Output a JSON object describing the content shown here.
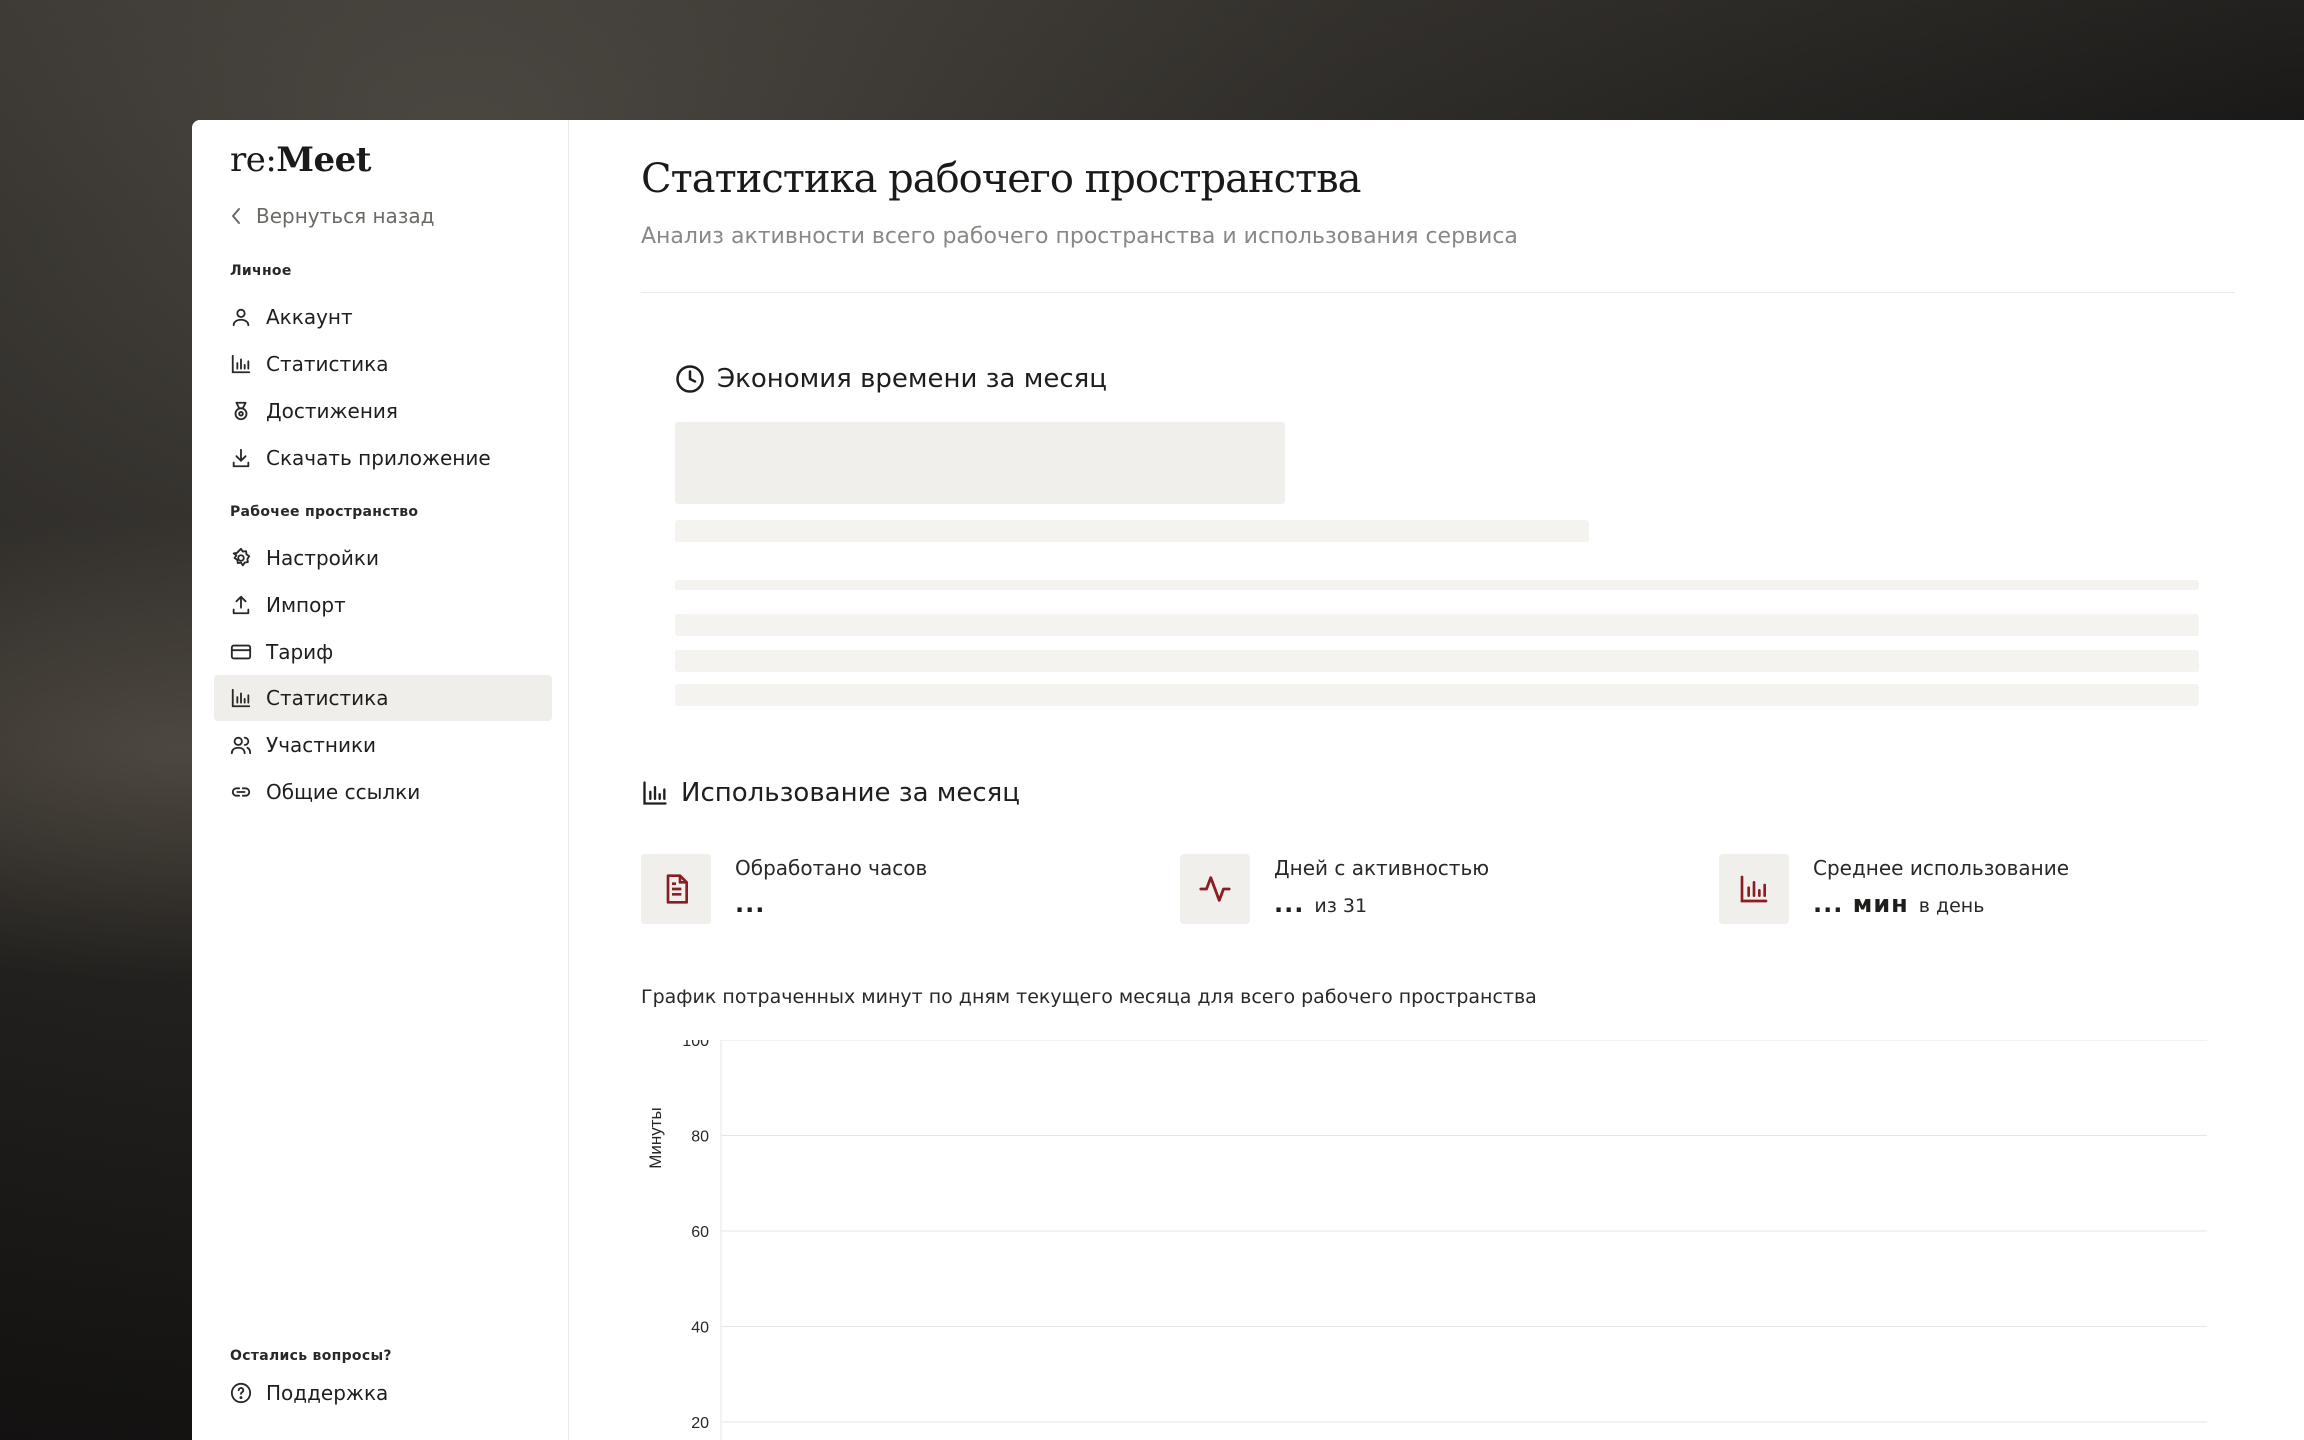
{
  "logo": {
    "prefix": "re:",
    "brand": "Meet"
  },
  "sidebar": {
    "back_label": "Вернуться назад",
    "personal_title": "Личное",
    "personal_items": [
      {
        "label": "Аккаунт",
        "icon": "user-icon"
      },
      {
        "label": "Статистика",
        "icon": "bar-chart-icon"
      },
      {
        "label": "Достижения",
        "icon": "medal-icon"
      },
      {
        "label": "Скачать приложение",
        "icon": "download-icon"
      }
    ],
    "workspace_title": "Рабочее пространство",
    "workspace_items": [
      {
        "label": "Настройки",
        "icon": "gear-icon"
      },
      {
        "label": "Импорт",
        "icon": "upload-icon"
      },
      {
        "label": "Тариф",
        "icon": "credit-card-icon"
      },
      {
        "label": "Статистика",
        "icon": "bar-chart-icon",
        "active": true
      },
      {
        "label": "Участники",
        "icon": "users-icon"
      },
      {
        "label": "Общие ссылки",
        "icon": "link-icon"
      }
    ],
    "footer_title": "Остались вопросы?",
    "support_label": "Поддержка"
  },
  "main": {
    "title": "Статистика рабочего пространства",
    "subtitle": "Анализ активности всего рабочего пространства и использования сервиса",
    "savings_title": "Экономия времени за месяц",
    "usage_title": "Использование за месяц",
    "stats": [
      {
        "label": "Обработано часов",
        "value": "...",
        "suffix": "",
        "icon": "document-icon"
      },
      {
        "label": "Дней с активностью",
        "value": "...",
        "suffix": "из 31",
        "icon": "activity-icon"
      },
      {
        "label": "Среднее использование",
        "value": "... мин",
        "suffix": "в день",
        "icon": "bar-chart-icon"
      }
    ],
    "chart_caption": "График потраченных минут по дням текущего месяца для всего рабочего пространства"
  },
  "colors": {
    "accent": "#8b1e22",
    "sidebar_active": "#efeeea",
    "skeleton": "#f4f3f0"
  },
  "chart_data": {
    "type": "line",
    "x": [],
    "series": [],
    "ylabel": "Минуты",
    "ylim": [
      0,
      100
    ],
    "yticks": [
      100,
      80,
      60,
      40,
      20
    ],
    "grid": true
  }
}
